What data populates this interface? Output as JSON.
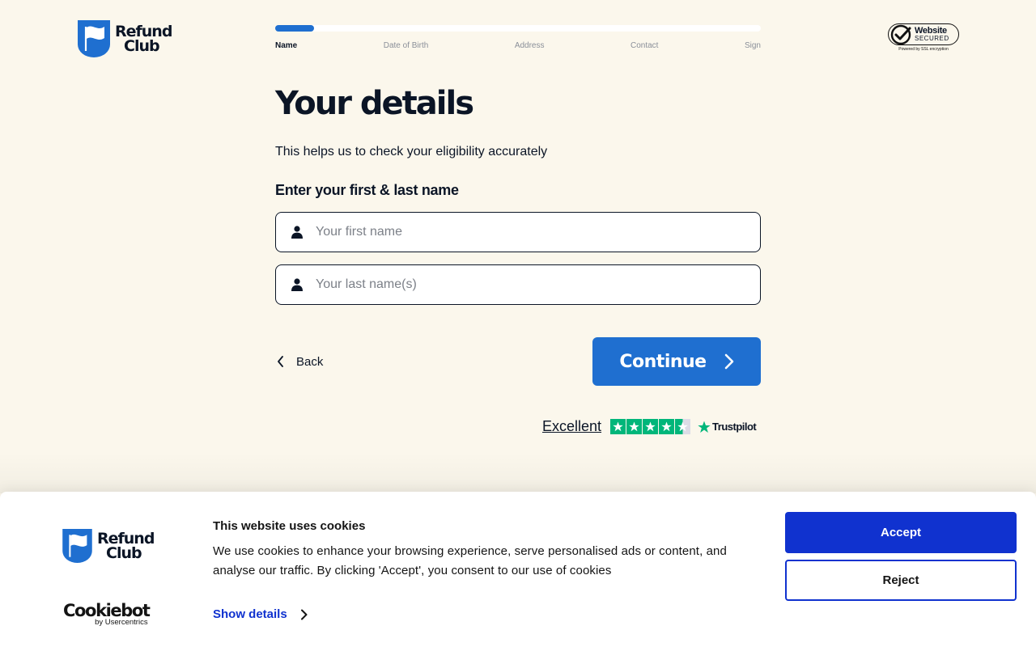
{
  "brand": {
    "name_line1": "Refund",
    "name_line2": "Club",
    "color": "#1f6fd0"
  },
  "progress": {
    "value": 0.08,
    "steps": [
      {
        "label": "Name",
        "active": true
      },
      {
        "label": "Date of Birth",
        "active": false
      },
      {
        "label": "Address",
        "active": false
      },
      {
        "label": "Contact",
        "active": false
      },
      {
        "label": "Sign",
        "active": false
      }
    ]
  },
  "secured": {
    "line1": "Website",
    "line2": "SECURED",
    "caption": "Powered by SSL encryption",
    "icon": "check-circle-icon"
  },
  "form": {
    "title": "Your details",
    "subtitle": "This helps us to check your eligibility accurately",
    "label": "Enter your first & last name",
    "first_name": {
      "placeholder": "Your first name",
      "value": "",
      "icon": "user-icon"
    },
    "last_name": {
      "placeholder": "Your last name(s)",
      "value": "",
      "icon": "user-icon"
    },
    "back_label": "Back",
    "continue_label": "Continue"
  },
  "trustpilot": {
    "rating_text": "Excellent",
    "stars": 4.5,
    "brand": "Trustpilot",
    "color": "#00b67a"
  },
  "cookie": {
    "title": "This website uses cookies",
    "text": "We use cookies to enhance your browsing experience, serve personalised ads or content, and analyse our traffic. By clicking 'Accept', you consent to our use of cookies",
    "details_label": "Show details",
    "accept_label": "Accept",
    "reject_label": "Reject",
    "provider_name": "Cookiebot",
    "provider_sub": "by Usercentrics",
    "accent": "#1032cf"
  }
}
